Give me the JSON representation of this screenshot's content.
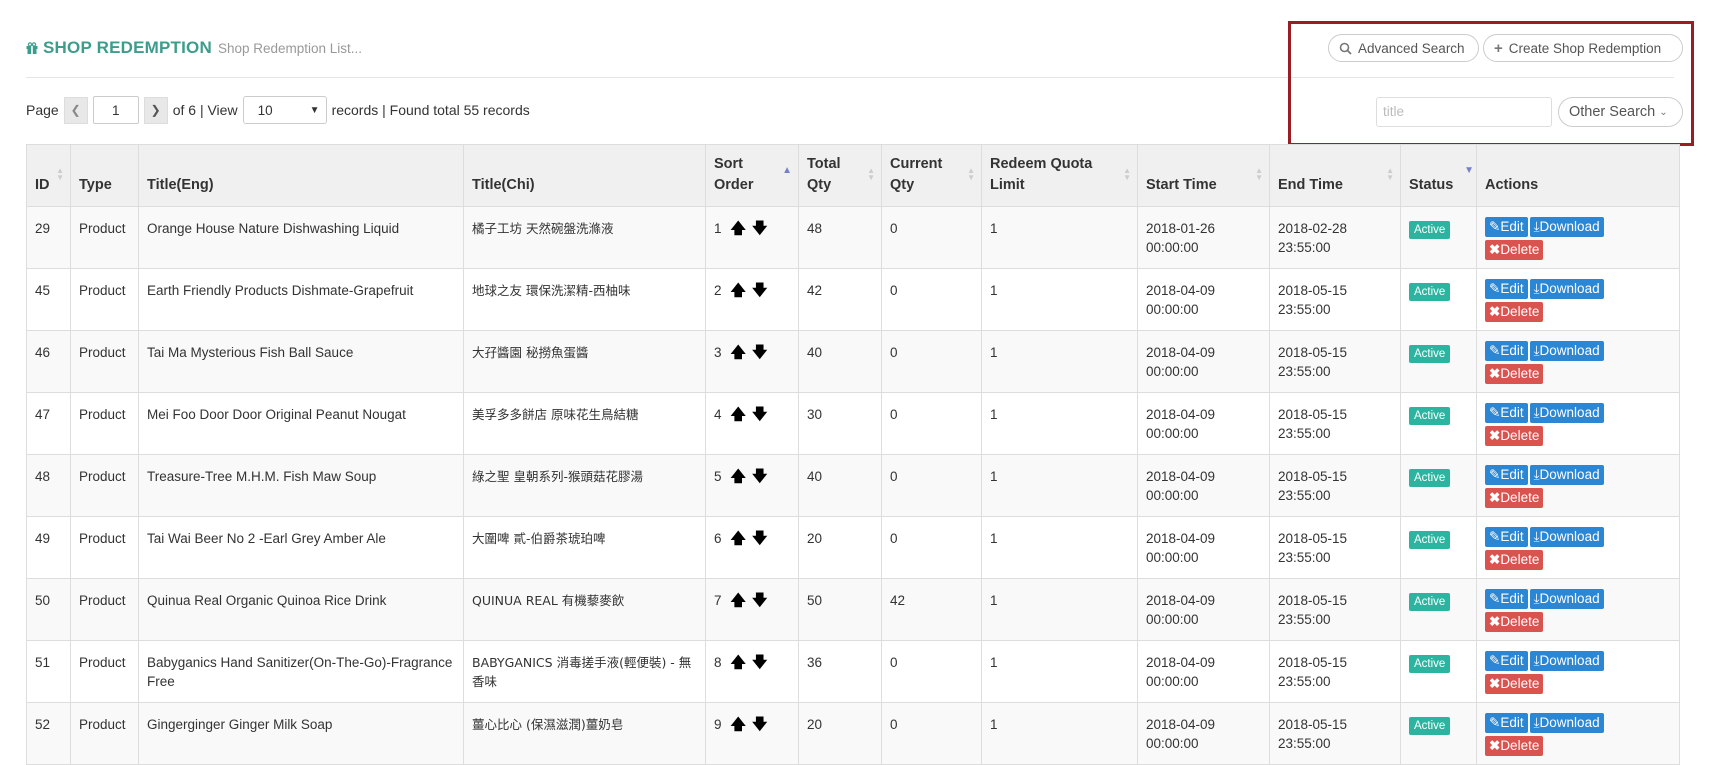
{
  "header": {
    "title": "SHOP REDEMPTION",
    "subtitle": "Shop Redemption List..."
  },
  "toolbar": {
    "advanced_search": "Advanced Search",
    "create": "Create Shop Redemption",
    "search_placeholder": "title",
    "other_search": "Other Search"
  },
  "pager": {
    "page_label": "Page",
    "page": "1",
    "of_text": "of 6 | View",
    "view": "10",
    "records_text": "records | Found total 55 records"
  },
  "table": {
    "columns": [
      "ID",
      "Type",
      "Title(Eng)",
      "Title(Chi)",
      "Sort Order",
      "Total Qty",
      "Current Qty",
      "Redeem Quota Limit",
      "Start Time",
      "End Time",
      "Status",
      "Actions"
    ],
    "actions": {
      "edit": "Edit",
      "download": "Download",
      "delete": "Delete"
    },
    "rows": [
      {
        "id": "29",
        "type": "Product",
        "eng": "Orange House Nature Dishwashing Liquid",
        "chi": "橘子工坊 天然碗盤洗滌液",
        "sort": "1",
        "total": "48",
        "current": "0",
        "quota": "1",
        "start": "2018-01-26 00:00:00",
        "end": "2018-02-28 23:55:00",
        "status": "Active"
      },
      {
        "id": "45",
        "type": "Product",
        "eng": "Earth Friendly Products Dishmate-Grapefruit",
        "chi": "地球之友 環保洗潔精-西柚味",
        "sort": "2",
        "total": "42",
        "current": "0",
        "quota": "1",
        "start": "2018-04-09 00:00:00",
        "end": "2018-05-15 23:55:00",
        "status": "Active"
      },
      {
        "id": "46",
        "type": "Product",
        "eng": "Tai Ma Mysterious Fish Ball Sauce",
        "chi": "大孖醬園 秘撈魚蛋醬",
        "sort": "3",
        "total": "40",
        "current": "0",
        "quota": "1",
        "start": "2018-04-09 00:00:00",
        "end": "2018-05-15 23:55:00",
        "status": "Active"
      },
      {
        "id": "47",
        "type": "Product",
        "eng": "Mei Foo Door Door Original Peanut Nougat",
        "chi": "美孚多多餅店 原味花生鳥結糖",
        "sort": "4",
        "total": "30",
        "current": "0",
        "quota": "1",
        "start": "2018-04-09 00:00:00",
        "end": "2018-05-15 23:55:00",
        "status": "Active"
      },
      {
        "id": "48",
        "type": "Product",
        "eng": "Treasure-Tree M.H.M. Fish Maw Soup",
        "chi": "綠之聖 皇朝系列-猴頭菇花膠湯",
        "sort": "5",
        "total": "40",
        "current": "0",
        "quota": "1",
        "start": "2018-04-09 00:00:00",
        "end": "2018-05-15 23:55:00",
        "status": "Active"
      },
      {
        "id": "49",
        "type": "Product",
        "eng": "Tai Wai Beer No 2 -Earl Grey Amber Ale",
        "chi": "大圍啤 貳-伯爵茶琥珀啤",
        "sort": "6",
        "total": "20",
        "current": "0",
        "quota": "1",
        "start": "2018-04-09 00:00:00",
        "end": "2018-05-15 23:55:00",
        "status": "Active"
      },
      {
        "id": "50",
        "type": "Product",
        "eng": "Quinua Real Organic Quinoa Rice Drink",
        "chi": "QUINUA REAL 有機藜麥飲",
        "sort": "7",
        "total": "50",
        "current": "42",
        "quota": "1",
        "start": "2018-04-09 00:00:00",
        "end": "2018-05-15 23:55:00",
        "status": "Active"
      },
      {
        "id": "51",
        "type": "Product",
        "eng": "Babyganics Hand Sanitizer(On-The-Go)-Fragrance Free",
        "chi": "BABYGANICS 消毒搓手液(輕便裝) - 無香味",
        "sort": "8",
        "total": "36",
        "current": "0",
        "quota": "1",
        "start": "2018-04-09 00:00:00",
        "end": "2018-05-15 23:55:00",
        "status": "Active"
      },
      {
        "id": "52",
        "type": "Product",
        "eng": "Gingerginger Ginger Milk Soap",
        "chi": "薑心比心 (保濕滋潤)薑奶皂",
        "sort": "9",
        "total": "20",
        "current": "0",
        "quota": "1",
        "start": "2018-04-09 00:00:00",
        "end": "2018-05-15 23:55:00",
        "status": "Active"
      }
    ]
  },
  "colors": {
    "accent": "#3d9d8d",
    "badge": "#2bb5a1",
    "primary": "#2b86d4",
    "danger": "#d9534f",
    "highlight_box": "#9c1c25"
  }
}
